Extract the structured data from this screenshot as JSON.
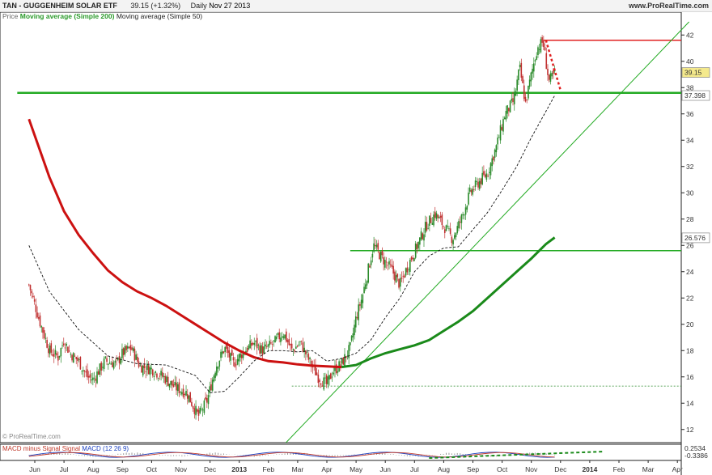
{
  "header": {
    "symbol": "TAN - GUGGENHEIM SOLAR ETF",
    "quote": "39.15 (+1.32%)",
    "period": "Daily",
    "date": "Nov 27 2013",
    "site": "www.ProRealTime.com"
  },
  "legend": {
    "price": "Price",
    "ma200": "Moving average (Simple 200)",
    "ma50": "Moving average (Simple 50)"
  },
  "watermark": "© ProRealTime.com",
  "macd_legend": {
    "a": "MACD minus Signal Signal",
    "b": "MACD (12 26 9)"
  },
  "colors": {
    "ma200": "#cc1111",
    "ma50": "#111111",
    "greenline": "#22aa22",
    "redline": "#e02020",
    "candle_up": "#2a8a2a",
    "candle_down": "#c03030",
    "macd": "#1a3fc0",
    "macd_signal": "#c0392b"
  },
  "chart_data": {
    "type": "candlestick",
    "ylim": [
      11,
      43
    ],
    "yticks": [
      12,
      14,
      16,
      18,
      20,
      22,
      24,
      26,
      28,
      30,
      32,
      34,
      36,
      38,
      40,
      42
    ],
    "x_labels": [
      "Jun",
      "Jul",
      "Aug",
      "Sep",
      "Oct",
      "Nov",
      "Dec",
      "2013",
      "Feb",
      "Mar",
      "Apr",
      "May",
      "Jun",
      "Jul",
      "Aug",
      "Sep",
      "Oct",
      "Nov",
      "Dec",
      "2014",
      "Feb",
      "Mar",
      "Apr"
    ],
    "x_months": [
      0,
      1,
      2,
      3,
      4,
      5,
      6,
      7,
      8,
      9,
      10,
      11,
      12,
      13,
      14,
      15,
      16,
      17,
      18,
      19,
      20,
      21,
      22
    ],
    "price_path": [
      [
        -0.2,
        23.0
      ],
      [
        0.2,
        20.0
      ],
      [
        0.5,
        18.0
      ],
      [
        0.8,
        17.5
      ],
      [
        1.0,
        18.8
      ],
      [
        1.2,
        17.8
      ],
      [
        1.5,
        17.2
      ],
      [
        1.8,
        16.0
      ],
      [
        2.0,
        15.8
      ],
      [
        2.4,
        17.2
      ],
      [
        2.8,
        17.0
      ],
      [
        3.0,
        17.8
      ],
      [
        3.3,
        18.2
      ],
      [
        3.6,
        16.8
      ],
      [
        4.0,
        16.6
      ],
      [
        4.4,
        16.0
      ],
      [
        4.8,
        15.2
      ],
      [
        5.2,
        14.8
      ],
      [
        5.6,
        13.0
      ],
      [
        5.9,
        14.2
      ],
      [
        6.2,
        16.8
      ],
      [
        6.5,
        18.2
      ],
      [
        6.8,
        17.0
      ],
      [
        7.1,
        17.8
      ],
      [
        7.5,
        18.6
      ],
      [
        7.8,
        18.0
      ],
      [
        8.2,
        18.6
      ],
      [
        8.5,
        19.4
      ],
      [
        8.8,
        18.0
      ],
      [
        9.1,
        18.6
      ],
      [
        9.4,
        17.2
      ],
      [
        9.7,
        16.0
      ],
      [
        10.0,
        15.4
      ],
      [
        10.2,
        16.4
      ],
      [
        10.5,
        17.0
      ],
      [
        10.8,
        18.2
      ],
      [
        11.0,
        20.5
      ],
      [
        11.2,
        22.0
      ],
      [
        11.4,
        24.0
      ],
      [
        11.6,
        26.0
      ],
      [
        11.9,
        25.0
      ],
      [
        12.2,
        24.2
      ],
      [
        12.5,
        23.0
      ],
      [
        12.8,
        24.6
      ],
      [
        13.1,
        26.0
      ],
      [
        13.4,
        27.5
      ],
      [
        13.7,
        28.4
      ],
      [
        14.0,
        27.5
      ],
      [
        14.3,
        26.5
      ],
      [
        14.6,
        28.0
      ],
      [
        14.9,
        30.0
      ],
      [
        15.2,
        30.8
      ],
      [
        15.5,
        31.5
      ],
      [
        15.8,
        33.5
      ],
      [
        16.1,
        36.0
      ],
      [
        16.4,
        37.0
      ],
      [
        16.6,
        39.5
      ],
      [
        16.8,
        36.8
      ],
      [
        17.0,
        39.0
      ],
      [
        17.2,
        41.0
      ],
      [
        17.4,
        41.5
      ],
      [
        17.6,
        38.5
      ],
      [
        17.8,
        39.0
      ]
    ],
    "ma50": [
      [
        -0.2,
        26.0
      ],
      [
        0.5,
        22.5
      ],
      [
        1.5,
        19.6
      ],
      [
        2.5,
        17.6
      ],
      [
        3.5,
        17.0
      ],
      [
        4.5,
        16.9
      ],
      [
        5.5,
        16.1
      ],
      [
        6.0,
        14.8
      ],
      [
        6.5,
        14.9
      ],
      [
        7.0,
        16.0
      ],
      [
        7.5,
        17.2
      ],
      [
        8.0,
        18.0
      ],
      [
        8.5,
        18.0
      ],
      [
        9.0,
        17.9
      ],
      [
        9.5,
        18.0
      ],
      [
        10.0,
        17.2
      ],
      [
        10.5,
        17.4
      ],
      [
        11.0,
        17.8
      ],
      [
        11.5,
        18.8
      ],
      [
        12.0,
        20.5
      ],
      [
        12.5,
        22.0
      ],
      [
        13.0,
        24.0
      ],
      [
        13.5,
        25.2
      ],
      [
        14.0,
        25.8
      ],
      [
        14.5,
        25.9
      ],
      [
        15.0,
        27.2
      ],
      [
        15.5,
        28.5
      ],
      [
        16.0,
        30.2
      ],
      [
        16.5,
        32.0
      ],
      [
        17.0,
        34.2
      ],
      [
        17.5,
        36.2
      ],
      [
        17.8,
        37.4
      ]
    ],
    "ma200": [
      [
        -0.2,
        35.6
      ],
      [
        0.5,
        31.2
      ],
      [
        1.0,
        28.6
      ],
      [
        1.5,
        26.8
      ],
      [
        2.0,
        25.4
      ],
      [
        2.5,
        24.1
      ],
      [
        3.0,
        23.2
      ],
      [
        3.5,
        22.5
      ],
      [
        4.0,
        22.0
      ],
      [
        4.5,
        21.4
      ],
      [
        5.0,
        20.7
      ],
      [
        5.5,
        20.0
      ],
      [
        6.0,
        19.3
      ],
      [
        6.5,
        18.6
      ],
      [
        7.0,
        18.0
      ],
      [
        7.5,
        17.5
      ],
      [
        8.0,
        17.2
      ],
      [
        8.5,
        17.1
      ],
      [
        9.0,
        16.95
      ],
      [
        9.5,
        16.85
      ],
      [
        10.0,
        16.8
      ],
      [
        10.5,
        16.75
      ]
    ],
    "ma200_continued": [
      [
        10.5,
        16.75
      ],
      [
        11.0,
        16.9
      ],
      [
        11.5,
        17.4
      ],
      [
        12.0,
        17.8
      ],
      [
        12.5,
        18.1
      ],
      [
        13.0,
        18.4
      ],
      [
        13.5,
        18.8
      ],
      [
        14.0,
        19.5
      ],
      [
        14.5,
        20.2
      ],
      [
        15.0,
        21.0
      ],
      [
        15.5,
        22.0
      ],
      [
        16.0,
        23.0
      ],
      [
        16.5,
        24.0
      ],
      [
        17.0,
        25.0
      ],
      [
        17.5,
        26.1
      ],
      [
        17.8,
        26.6
      ]
    ],
    "horizontal_lines": [
      {
        "y": 37.6,
        "x_from": -0.6,
        "x_to": 22.6,
        "kind": "green-thick"
      },
      {
        "y": 25.6,
        "x_from": 10.8,
        "x_to": 22.6,
        "kind": "green"
      },
      {
        "y": 41.6,
        "x_from": 17.4,
        "x_to": 22.6,
        "kind": "red"
      },
      {
        "y": 15.3,
        "x_from": 8.8,
        "x_to": 22.6,
        "kind": "dashed"
      }
    ],
    "trendline": {
      "from": [
        8.6,
        11.0
      ],
      "to": [
        22.4,
        43.0
      ]
    },
    "red_dotted": {
      "from": [
        17.5,
        41.6
      ],
      "to": [
        18.0,
        37.8
      ]
    },
    "price_labels": [
      {
        "value": 39.15,
        "text": "39.15",
        "style": "yellow"
      },
      {
        "value": 37.398,
        "text": "37.398",
        "style": "white"
      },
      {
        "value": 26.576,
        "text": "26.576",
        "style": "white"
      }
    ],
    "macd_labels": [
      {
        "text": "0.2534"
      },
      {
        "text": "-0.3386"
      }
    ]
  }
}
